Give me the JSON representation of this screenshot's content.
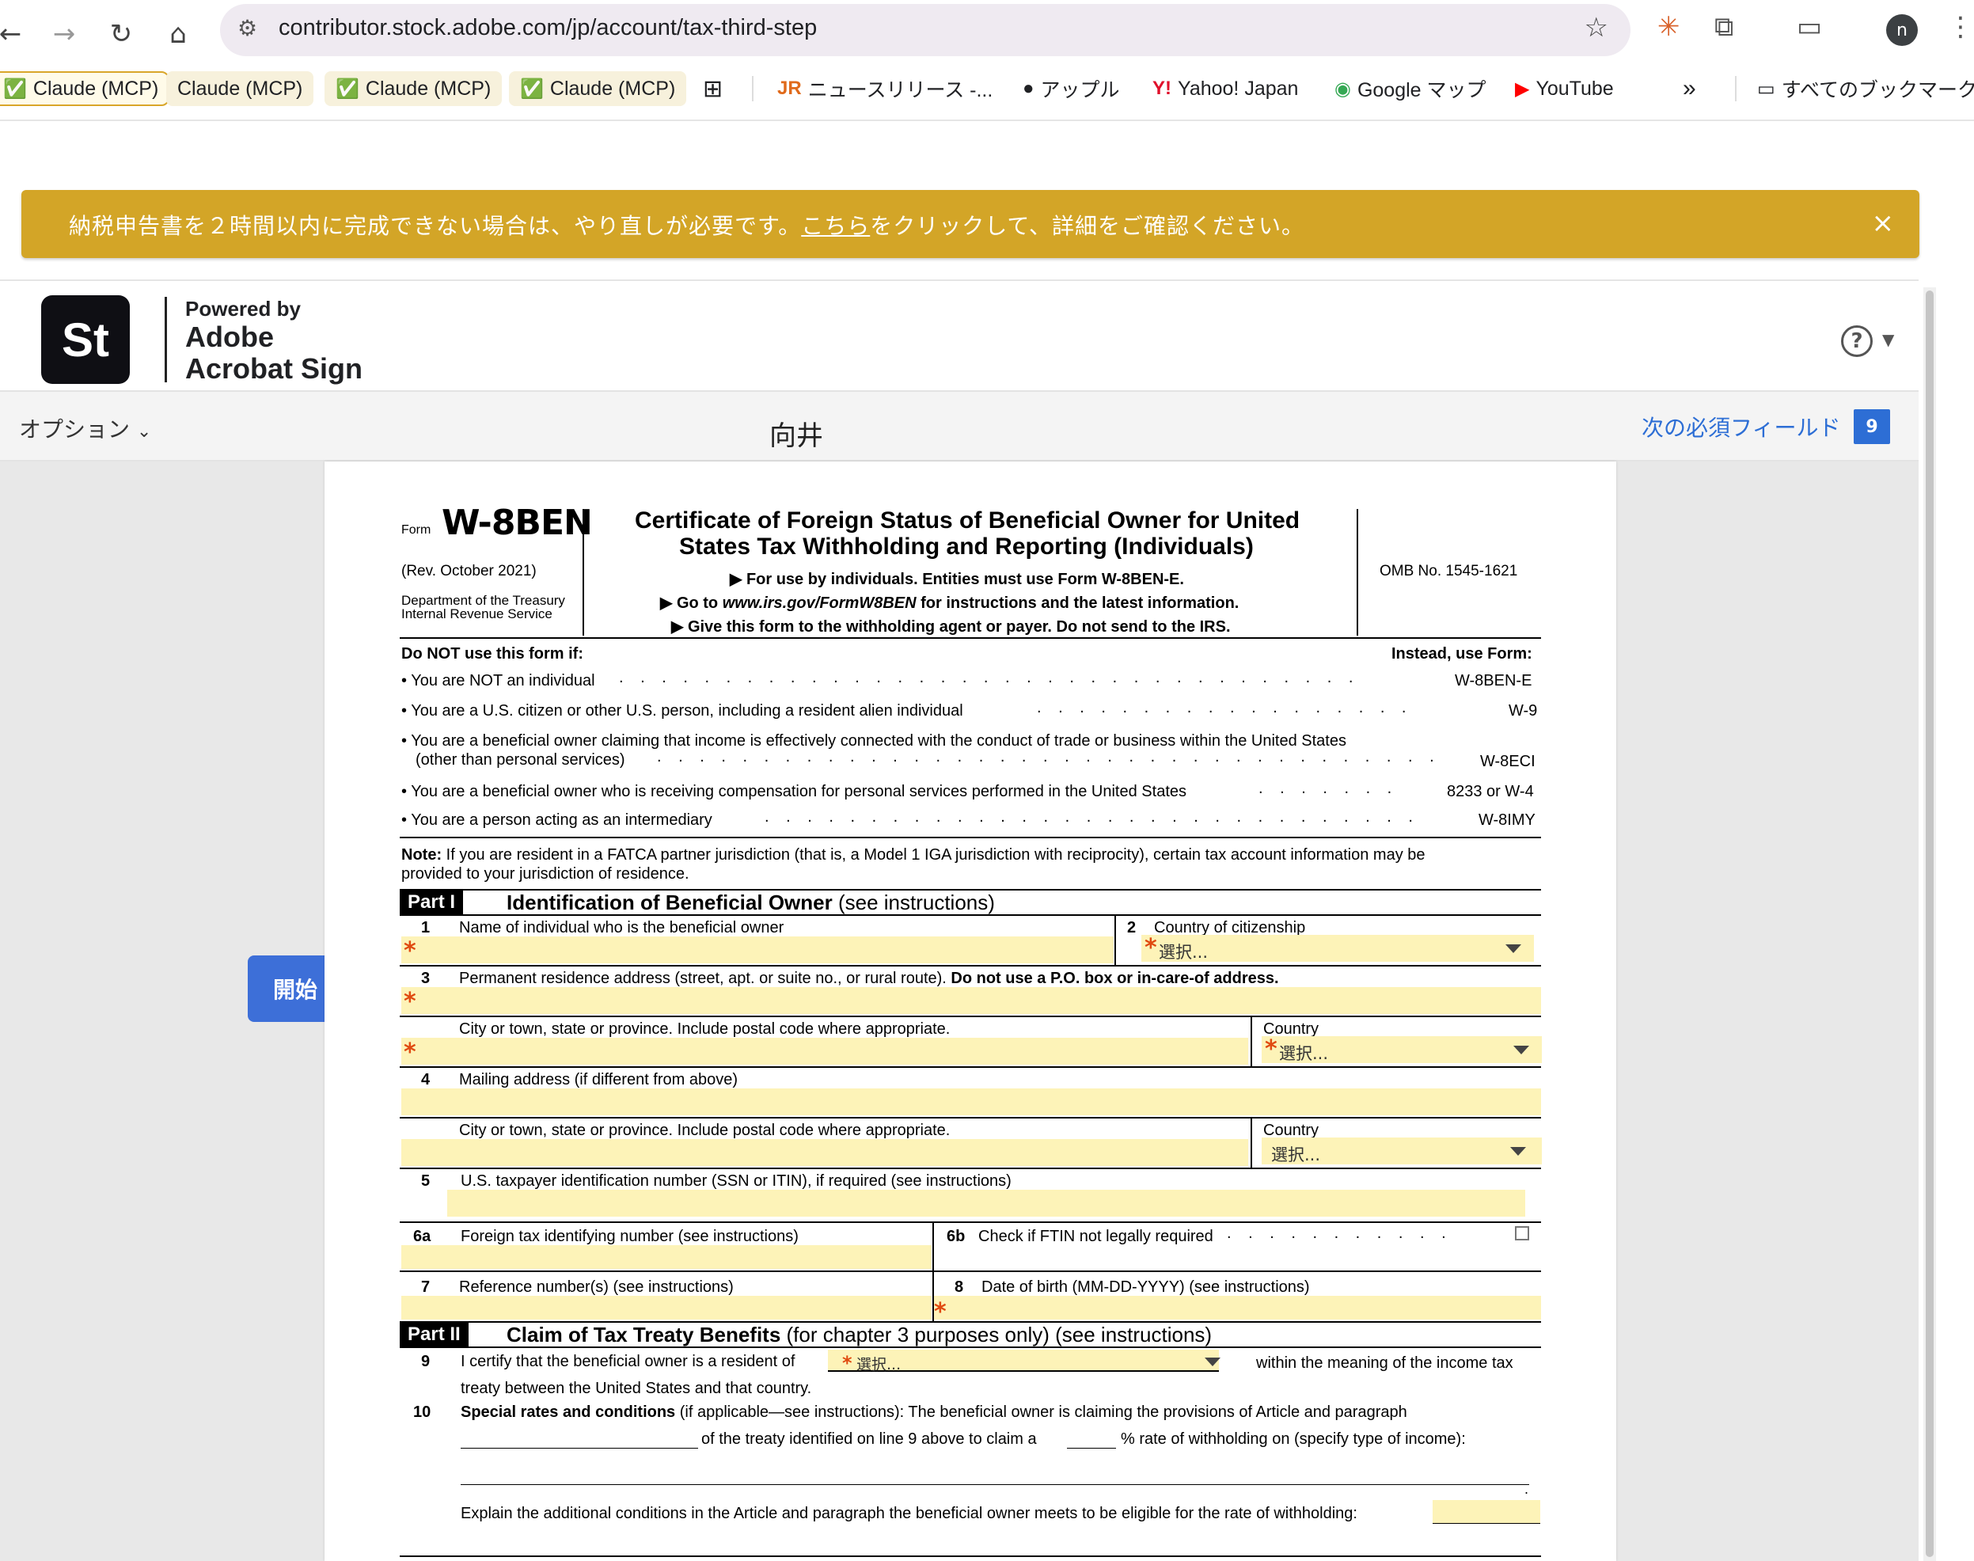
{
  "browser": {
    "url": "contributor.stock.adobe.com/jp/account/tax-third-step",
    "profile_initial": "n",
    "bookmarks": [
      {
        "label": "Claude (MCP)",
        "icon": "check"
      },
      {
        "label": "Claude (MCP)",
        "icon": ""
      },
      {
        "label": "Claude (MCP)",
        "icon": "check"
      },
      {
        "label": "Claude (MCP)",
        "icon": "check"
      },
      {
        "label": "ニュースリリース -...",
        "icon": "jr"
      },
      {
        "label": "アップル",
        "icon": "apple"
      },
      {
        "label": "Yahoo! Japan",
        "icon": "yahoo"
      },
      {
        "label": "Google マップ",
        "icon": "maps"
      },
      {
        "label": "YouTube",
        "icon": "youtube"
      }
    ],
    "all_bookmarks": "すべてのブックマーク",
    "overflow": "»"
  },
  "banner": {
    "text_before": "納税申告書を２時間以内に完成できない場合は、やり直しが必要です。",
    "link": "こちら",
    "text_after": "をクリックして、詳細をご確認ください。",
    "close": "×"
  },
  "sign_header": {
    "logo": "St",
    "powered": "Powered by",
    "brand1": "Adobe",
    "brand2": "Acrobat Sign",
    "help": "?"
  },
  "toolbar": {
    "options": "オプション",
    "signer": "向井",
    "next_required": "次の必須フィールド",
    "remaining": "9"
  },
  "start_tag": "開始",
  "form": {
    "form_word": "Form",
    "form_no": "W-8BEN",
    "rev": "(Rev. October  2021)",
    "dept1": "Department of the Treasury",
    "dept2": "Internal Revenue Service",
    "title1": "Certificate of Foreign Status of Beneficial Owner for United",
    "title2": "States Tax Withholding and Reporting (Individuals)",
    "sub1": "▶ For use by individuals. Entities must use Form W-8BEN-E.",
    "sub2_pre": "▶ Go to ",
    "sub2_url": "www.irs.gov/FormW8BEN",
    "sub2_post": " for instructions and the latest information.",
    "sub3": "▶ Give this form to the withholding agent or payer. Do not send to the IRS.",
    "omb": "OMB No. 1545-1621",
    "donot": "Do NOT use this form if:",
    "instead": "Instead, use Form:",
    "rows": [
      {
        "text": "• You are NOT an individual",
        "form": "W-8BEN-E"
      },
      {
        "text": "• You are a U.S. citizen or other U.S. person, including a resident alien individual",
        "form": "W-9"
      },
      {
        "text": "• You are a beneficial owner claiming that income is effectively connected with the conduct of trade or business within the United States",
        "text2": "(other than personal services)",
        "form": "W-8ECI"
      },
      {
        "text": "• You are a beneficial owner who is receiving compensation for personal services performed in the United States",
        "form": "8233 or W-4"
      },
      {
        "text": "• You are a person acting as an intermediary",
        "form": "W-8IMY"
      }
    ],
    "note_b": "Note:",
    "note1": " If you are resident in a FATCA partner jurisdiction (that is, a Model 1 IGA jurisdiction with reciprocity), certain tax account information may be",
    "note2": "provided to your jurisdiction of residence.",
    "part1": {
      "label": "Part I",
      "title": "Identification of Beneficial Owner",
      "sub": " (see instructions)"
    },
    "l1n": "1",
    "l1": "Name of individual who is the beneficial owner",
    "l2n": "2",
    "l2": "Country of citizenship",
    "l3n": "3",
    "l3": "Permanent residence address (street, apt. or suite no., or rural route). ",
    "l3b": "Do not use a P.O. box or in-care-of address.",
    "city": "City or town, state or province. Include postal code where appropriate.",
    "country": "Country",
    "l4n": "4",
    "l4": "Mailing address (if different from above)",
    "l5n": "5",
    "l5": "U.S. taxpayer identification number (SSN or ITIN), if required (see instructions)",
    "l6an": "6a",
    "l6a": "Foreign tax identifying number (see instructions)",
    "l6bn": "6b",
    "l6b": "Check if FTIN not legally required",
    "l7n": "7",
    "l7": "Reference number(s) (see instructions)",
    "l8n": "8",
    "l8": "Date of birth (MM-DD-YYYY) (see instructions)",
    "part2": {
      "label": "Part II",
      "title": "Claim of Tax Treaty Benefits",
      "sub": " (for chapter 3 purposes only) (see instructions)"
    },
    "l9n": "9",
    "l9a": "I certify that the beneficial owner is a resident of",
    "l9b": "within the meaning of the income tax",
    "l9c": "treaty between the United States and that country.",
    "l10n": "10",
    "l10b": "Special rates and conditions",
    "l10a": " (if applicable—see instructions): The beneficial owner is claiming the provisions of Article and paragraph",
    "l10c": "of the treaty identified on line 9 above to claim a",
    "l10d": "% rate of withholding on (specify type of income):",
    "l10e": "Explain the additional conditions in the Article and paragraph the beneficial owner meets to be eligible for the rate of withholding:",
    "select_placeholder": "選択...",
    "required_mark": "*"
  }
}
